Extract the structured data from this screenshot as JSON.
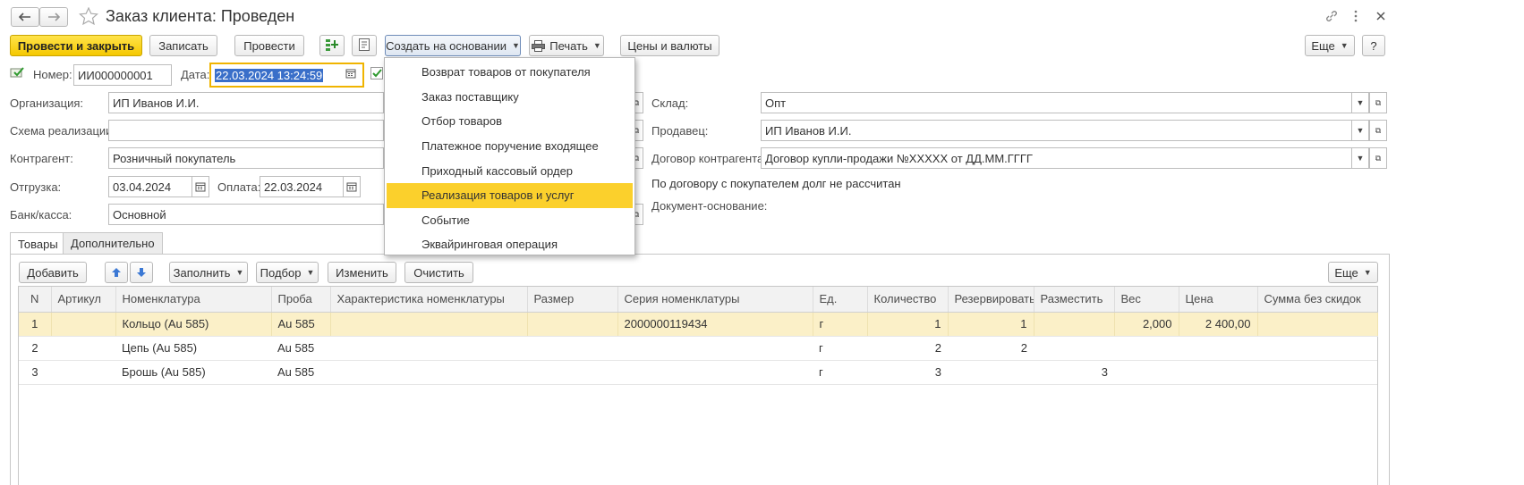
{
  "window": {
    "title": "Заказ клиента: Проведен",
    "icons": [
      "back-arrow-icon",
      "forward-arrow-icon",
      "star-icon",
      "link-icon",
      "more-vertical-icon",
      "close-icon"
    ]
  },
  "toolbar": {
    "post_close": "Провести и закрыть",
    "save": "Записать",
    "post": "Провести",
    "create_based": "Создать на основании",
    "print": "Печать",
    "prices": "Цены и валюты",
    "more": "Еще",
    "help": "?"
  },
  "header": {
    "number_label": "Номер:",
    "number_value": "ИИ000000001",
    "date_label": "Дата:",
    "date_value": "22.03.2024 13:24:59",
    "org_label": "Организация:",
    "org_value": "ИП Иванов И.И.",
    "scheme_label": "Схема реализации:",
    "scheme_value": "",
    "partner_label": "Контрагент:",
    "partner_value": "Розничный покупатель",
    "ship_label": "Отгрузка:",
    "ship_value": "03.04.2024",
    "pay_label": "Оплата:",
    "pay_value": "22.03.2024",
    "bank_label": "Банк/касса:",
    "bank_value": "Основной",
    "warehouse_label": "Склад:",
    "warehouse_value": "Опт",
    "seller_label": "Продавец:",
    "seller_value": "ИП Иванов И.И.",
    "contract_label": "Договор контрагента:",
    "contract_value": "Договор купли-продажи №XXXXX от ДД.ММ.ГГГГ",
    "debt_note": "По договору с покупателем долг не рассчитан",
    "basis_label": "Документ-основание:"
  },
  "dropdown_menu": {
    "items": [
      "Возврат товаров от покупателя",
      "Заказ поставщику",
      "Отбор товаров",
      "Платежное поручение входящее",
      "Приходный кассовый ордер",
      "Реализация товаров и услуг",
      "Событие",
      "Эквайринговая операция"
    ],
    "selected_index": 5
  },
  "tabs": [
    "Товары",
    "Дополнительно"
  ],
  "table_toolbar": {
    "add": "Добавить",
    "fill": "Заполнить",
    "pick": "Подбор",
    "edit": "Изменить",
    "clear": "Очистить",
    "more": "Еще"
  },
  "table": {
    "columns": [
      "N",
      "Артикул",
      "Номенклатура",
      "Проба",
      "Характеристика номенклатуры",
      "Размер",
      "Серия номенклатуры",
      "Ед.",
      "Количество",
      "Резервировать",
      "Разместить",
      "Вес",
      "Цена",
      "Сумма без скидок"
    ],
    "rows": [
      [
        "1",
        "",
        "Кольцо (Au 585)",
        "Au 585",
        "",
        "",
        "2000000119434",
        "г",
        "1",
        "1",
        "",
        "2,000",
        "2 400,00",
        ""
      ],
      [
        "2",
        "",
        "Цепь (Au 585)",
        "Au 585",
        "",
        "",
        "",
        "г",
        "2",
        "2",
        "",
        "",
        "",
        ""
      ],
      [
        "3",
        "",
        "Брошь (Au 585)",
        "Au 585",
        "",
        "",
        "",
        "г",
        "3",
        "",
        "3",
        "",
        "",
        ""
      ]
    ],
    "selected_row": 0
  },
  "colors": {
    "accent_yellow": "#fbd02c",
    "selected_row": "#fbf0c8",
    "date_focus_border": "#f0b400",
    "selection_blue": "#3a6fc9"
  }
}
